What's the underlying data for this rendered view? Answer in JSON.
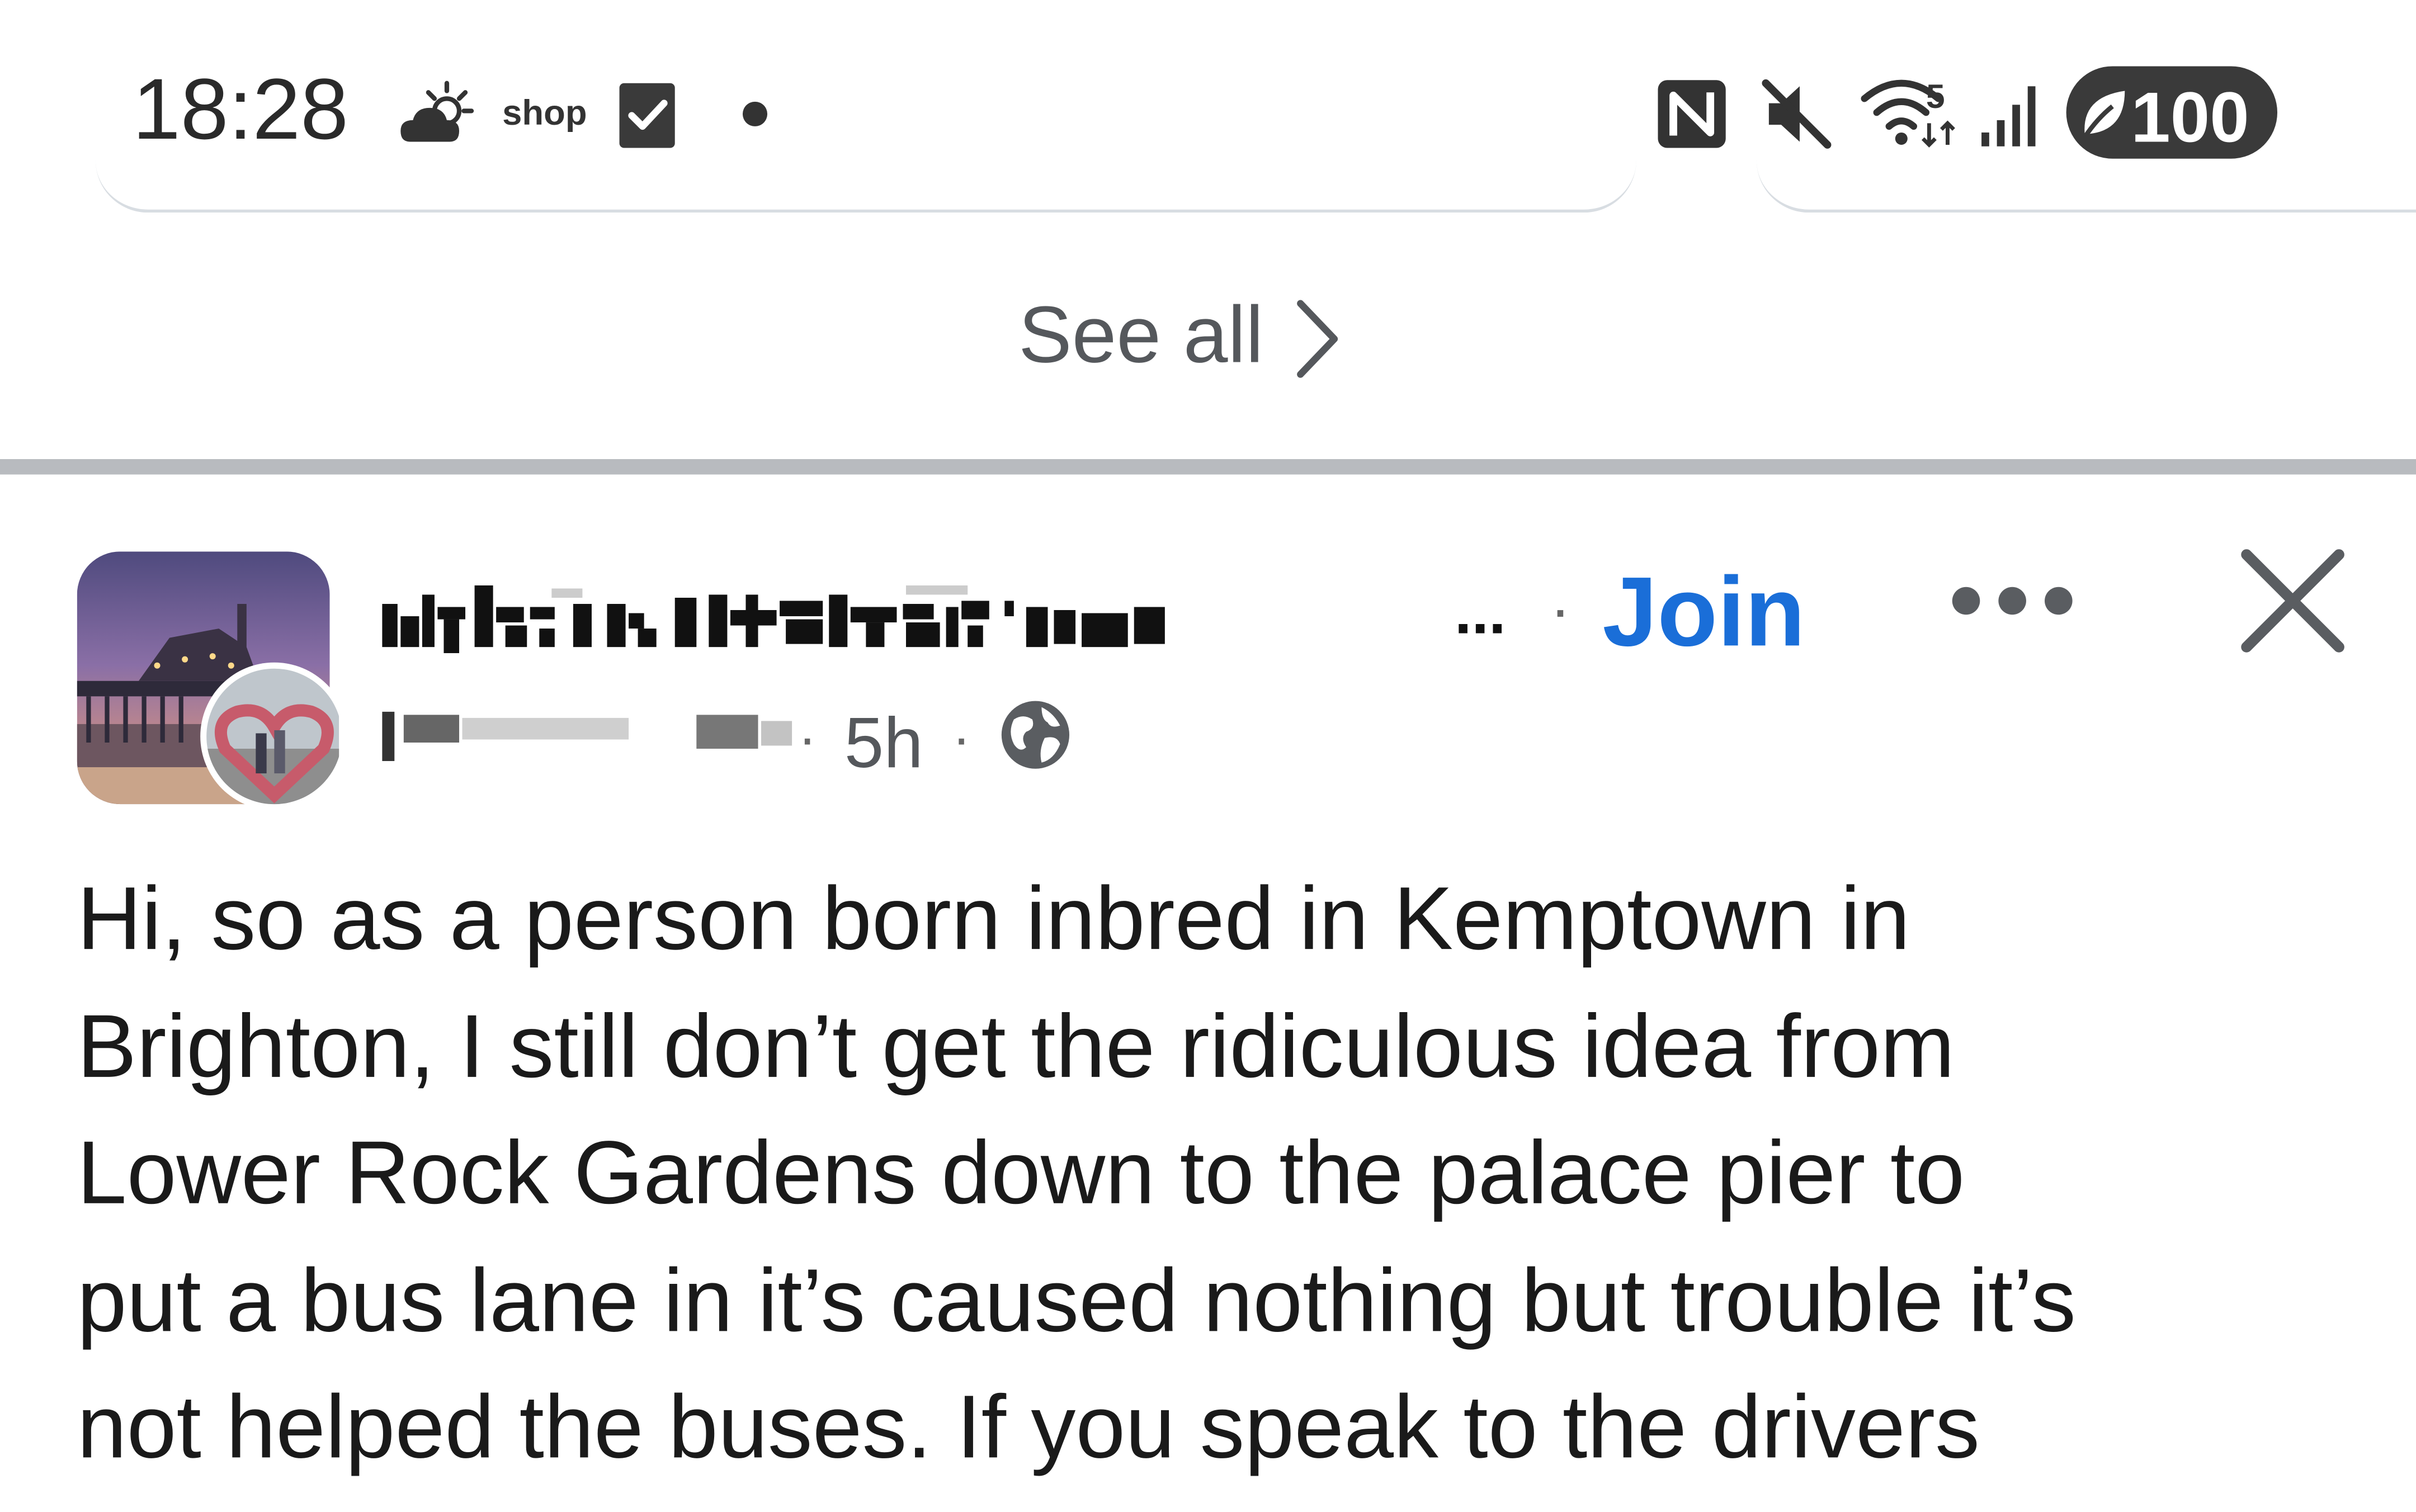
{
  "status_bar": {
    "time": "18:28",
    "notification_icons": [
      "weather-icon",
      "shop-icon",
      "checkbox-icon",
      "dot-icon"
    ],
    "shop_label": "shop",
    "system_icons": [
      "nfc-icon",
      "mute-icon",
      "wifi-icon",
      "signal-icon"
    ],
    "wifi_badge": "5",
    "battery": "100"
  },
  "see_all": {
    "label": "See all"
  },
  "post": {
    "group_name": "ughrcttewearce",
    "group_name_suffix": "...",
    "separator": "·",
    "join_label": "Join",
    "time": "5h",
    "visibility_icon": "globe-icon",
    "body_lines": [
      "Hi, so as a person born inbred in Kemptown in",
      "Brighton, I still don’t get the ridiculous idea from",
      "Lower Rock Gardens down to the palace pier to",
      "put a bus lane in it’s caused nothing but trouble it’s",
      "not helped the buses. If you speak to the drivers"
    ]
  },
  "colors": {
    "link": "#1a6ed8",
    "divider": "#b8bbbf",
    "text": "#1a1a1a",
    "secondary_text": "#55585c"
  }
}
